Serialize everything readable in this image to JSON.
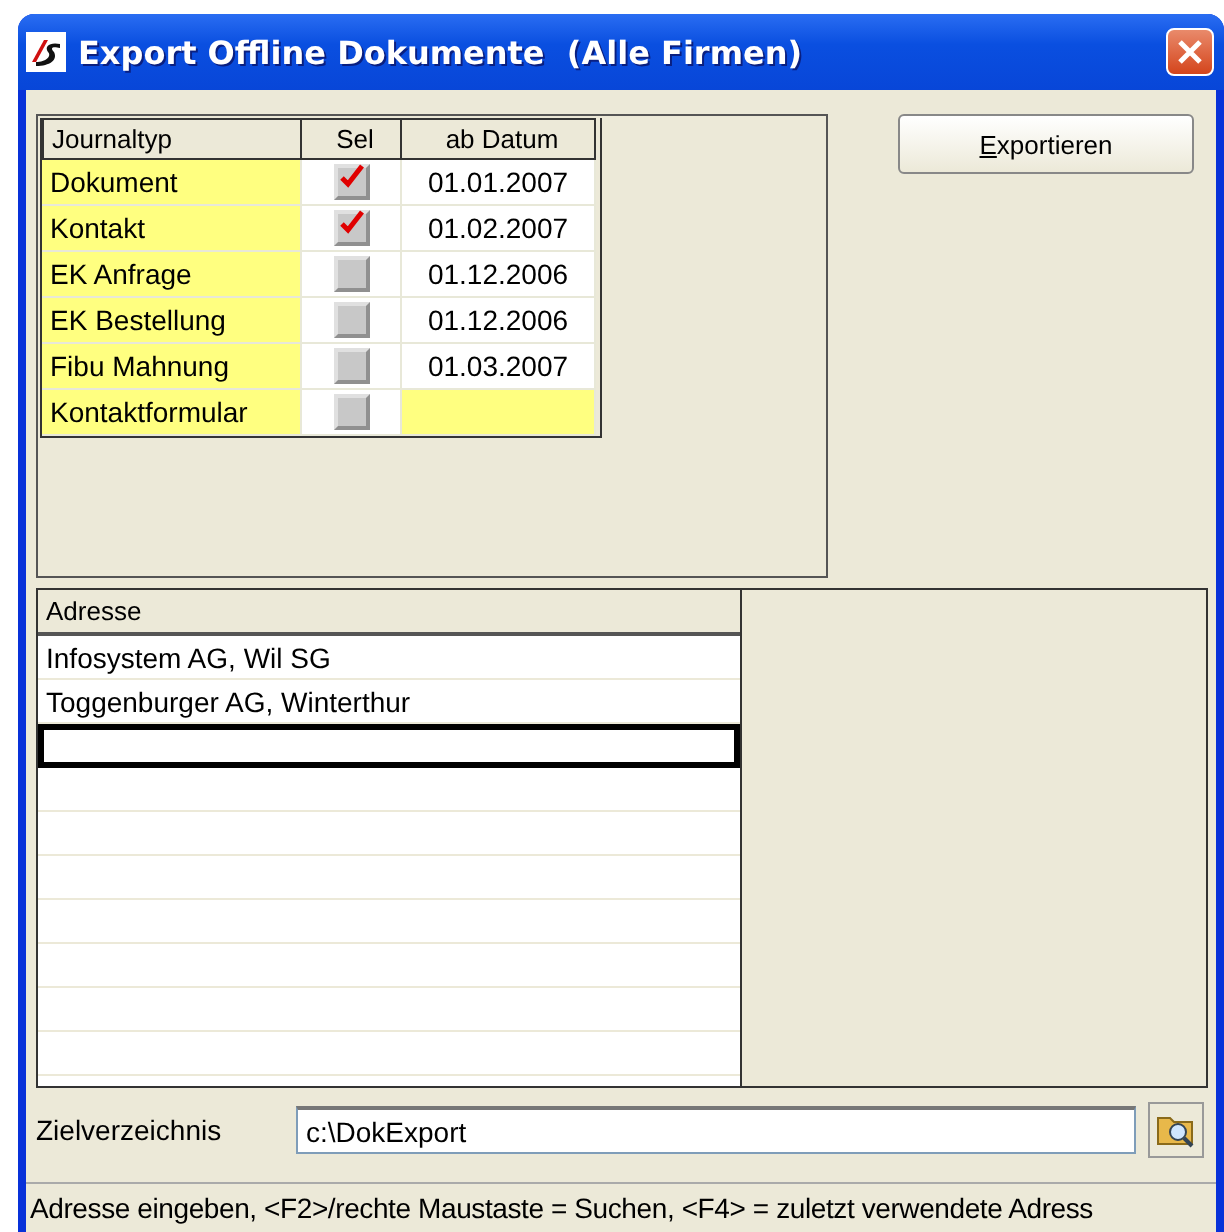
{
  "window": {
    "title": "Export Offline Dokumente  (Alle Firmen)"
  },
  "journal": {
    "columns": [
      "Journaltyp",
      "Sel",
      "ab Datum"
    ],
    "rows": [
      {
        "type": "Dokument",
        "checked": true,
        "date": "01.01.2007"
      },
      {
        "type": "Kontakt",
        "checked": true,
        "date": "01.02.2007"
      },
      {
        "type": "EK Anfrage",
        "checked": false,
        "date": "01.12.2006"
      },
      {
        "type": "EK Bestellung",
        "checked": false,
        "date": "01.12.2006"
      },
      {
        "type": "Fibu Mahnung",
        "checked": false,
        "date": "01.03.2007"
      },
      {
        "type": "Kontaktformular",
        "checked": false
      }
    ]
  },
  "export_button": {
    "label": "Exportieren"
  },
  "addresses": {
    "column": "Adresse",
    "rows": [
      {
        "text": "Infosystem AG, Wil SG"
      },
      {
        "text": "Toggenburger AG, Winterthur"
      }
    ],
    "new_row_selected": true
  },
  "target": {
    "label": "Zielverzeichnis",
    "value": "c:\\DokExport"
  },
  "status_bar": "Adresse eingeben, <F2>/rechte Maustaste = Suchen, <F4> = zuletzt verwendete Adress"
}
